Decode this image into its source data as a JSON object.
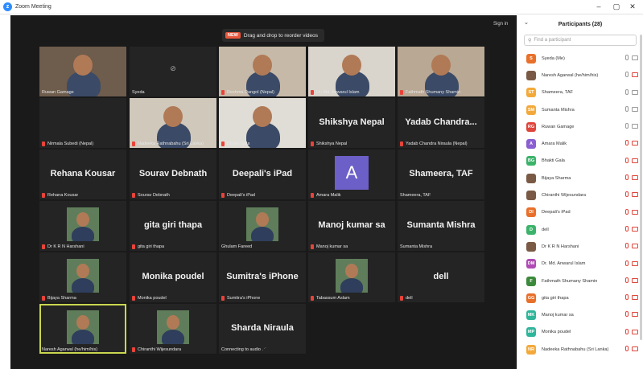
{
  "window": {
    "title": "Zoom Meeting",
    "controls": [
      "–",
      "▢",
      "✕"
    ]
  },
  "stage": {
    "banner_badge": "NEW",
    "banner_text": "Drag and drop to reorder videos",
    "sign_in": "Sign in",
    "tiles": [
      {
        "caption": "Ruwan Gamage",
        "muted": false,
        "kind": "photo"
      },
      {
        "caption": "Syeda",
        "muted": false,
        "kind": "camoff"
      },
      {
        "caption": "Reshma Dangol (Nepal)",
        "muted": true,
        "kind": "photo"
      },
      {
        "caption": "Dr. Md. Anwarul Islam",
        "muted": true,
        "kind": "photo"
      },
      {
        "caption": "Fathmath Shumany Shamin",
        "muted": true,
        "kind": "photo"
      },
      {
        "caption": "Nirmala Subedi (Nepal)",
        "muted": true,
        "kind": "blank"
      },
      {
        "caption": "Nadeeka Rathnabahu (Sri Lanka)",
        "muted": true,
        "kind": "photo"
      },
      {
        "caption": "Bhakti Gala",
        "muted": true,
        "kind": "photo"
      },
      {
        "big": "Shikshya Nepal",
        "caption": "Shikshya Nepal",
        "muted": true,
        "kind": "name"
      },
      {
        "big": "Yadab  Chandra...",
        "caption": "Yadab Chandra Niraula (Nepal)",
        "muted": true,
        "kind": "name"
      },
      {
        "big": "Rehana Kousar",
        "caption": "Rehana Kousar",
        "muted": true,
        "kind": "name"
      },
      {
        "big": "Sourav Debnath",
        "caption": "Sourav Debnath",
        "muted": true,
        "kind": "name"
      },
      {
        "big": "Deepali's iPad",
        "caption": "Deepali's iPad",
        "muted": true,
        "kind": "name"
      },
      {
        "initial": "A",
        "caption": "Amara Malik",
        "muted": true,
        "kind": "initial"
      },
      {
        "big": "Shameera, TAF",
        "caption": "Shameera, TAF",
        "muted": false,
        "kind": "name"
      },
      {
        "caption": "Dr K R N Harshani",
        "muted": true,
        "kind": "smallphoto"
      },
      {
        "big": "gita giri thapa",
        "caption": "gita giri thapa",
        "muted": true,
        "kind": "name"
      },
      {
        "caption": "Ghulam Fareed",
        "muted": false,
        "kind": "smallphoto"
      },
      {
        "big": "Manoj kumar sa",
        "caption": "Manoj kumar sa",
        "muted": true,
        "kind": "name"
      },
      {
        "big": "Sumanta Mishra",
        "caption": "Sumanta Mishra",
        "muted": false,
        "kind": "name"
      },
      {
        "caption": "Bijaya Sharma",
        "muted": true,
        "kind": "smallphoto"
      },
      {
        "big": "Monika poudel",
        "caption": "Monika poudel",
        "muted": true,
        "kind": "name"
      },
      {
        "big": "Sumitra's iPhone",
        "caption": "Sumitra's iPhone",
        "muted": true,
        "kind": "name"
      },
      {
        "caption": "Tabassum Aslam",
        "muted": true,
        "kind": "smallphoto"
      },
      {
        "big": "dell",
        "caption": "dell",
        "muted": true,
        "kind": "name"
      },
      {
        "caption": "Naresh Agarwal (he/him/his)",
        "muted": false,
        "kind": "smallphoto",
        "active": true
      },
      {
        "caption": "Chiranthi Wijesundara",
        "muted": true,
        "kind": "smallphoto"
      },
      {
        "big": "Sharda Niraula",
        "caption": "Connecting to audio ⋰",
        "muted": false,
        "kind": "name"
      }
    ]
  },
  "panel": {
    "title": "Participants (28)",
    "search_placeholder": "Find a participant",
    "participants": [
      {
        "name": "Syeda (Me)",
        "initials": "S",
        "color": "#e8702a",
        "mic_off": false,
        "vid_off": false
      },
      {
        "name": "Naresh Agarwal (he/him/his)",
        "initials": "",
        "color": "photo",
        "mic_off": false,
        "vid_off": true
      },
      {
        "name": "Shameera, TAF",
        "initials": "ST",
        "color": "#f3a93a",
        "mic_off": false,
        "vid_off": false
      },
      {
        "name": "Sumanta Mishra",
        "initials": "SM",
        "color": "#f3a93a",
        "mic_off": false,
        "vid_off": false
      },
      {
        "name": "Ruwan Gamage",
        "initials": "RG",
        "color": "#e0453b",
        "mic_off": false,
        "vid_off": false
      },
      {
        "name": "Amara Malik",
        "initials": "A",
        "color": "#8a5fd1",
        "mic_off": true,
        "vid_off": true
      },
      {
        "name": "Bhakti Gala",
        "initials": "BG",
        "color": "#3bb36a",
        "mic_off": true,
        "vid_off": true
      },
      {
        "name": "Bijaya Sharma",
        "initials": "",
        "color": "photo",
        "mic_off": true,
        "vid_off": true
      },
      {
        "name": "Chiranthi Wijesundara",
        "initials": "",
        "color": "photo",
        "mic_off": true,
        "vid_off": true
      },
      {
        "name": "Deepali's iPad",
        "initials": "DI",
        "color": "#e8702a",
        "mic_off": true,
        "vid_off": true
      },
      {
        "name": "dell",
        "initials": "D",
        "color": "#3bb36a",
        "mic_off": true,
        "vid_off": true
      },
      {
        "name": "Dr K R N Harshani",
        "initials": "",
        "color": "photo",
        "mic_off": true,
        "vid_off": true
      },
      {
        "name": "Dr. Md. Anwarul Islam",
        "initials": "DM",
        "color": "#b04bb5",
        "mic_off": true,
        "vid_off": true
      },
      {
        "name": "Fathmath Shumany Shamin",
        "initials": "F",
        "color": "#3b8a3b",
        "mic_off": true,
        "vid_off": true
      },
      {
        "name": "gita giri thapa",
        "initials": "GG",
        "color": "#e8702a",
        "mic_off": true,
        "vid_off": true
      },
      {
        "name": "Manoj kumar sa",
        "initials": "MK",
        "color": "#2fb59a",
        "mic_off": true,
        "vid_off": true
      },
      {
        "name": "Monika poudel",
        "initials": "MP",
        "color": "#2fb59a",
        "mic_off": true,
        "vid_off": true
      },
      {
        "name": "Nadeeka Rathnabahu (Sri Lanka)",
        "initials": "NR",
        "color": "#f3a93a",
        "mic_off": true,
        "vid_off": true
      }
    ]
  }
}
